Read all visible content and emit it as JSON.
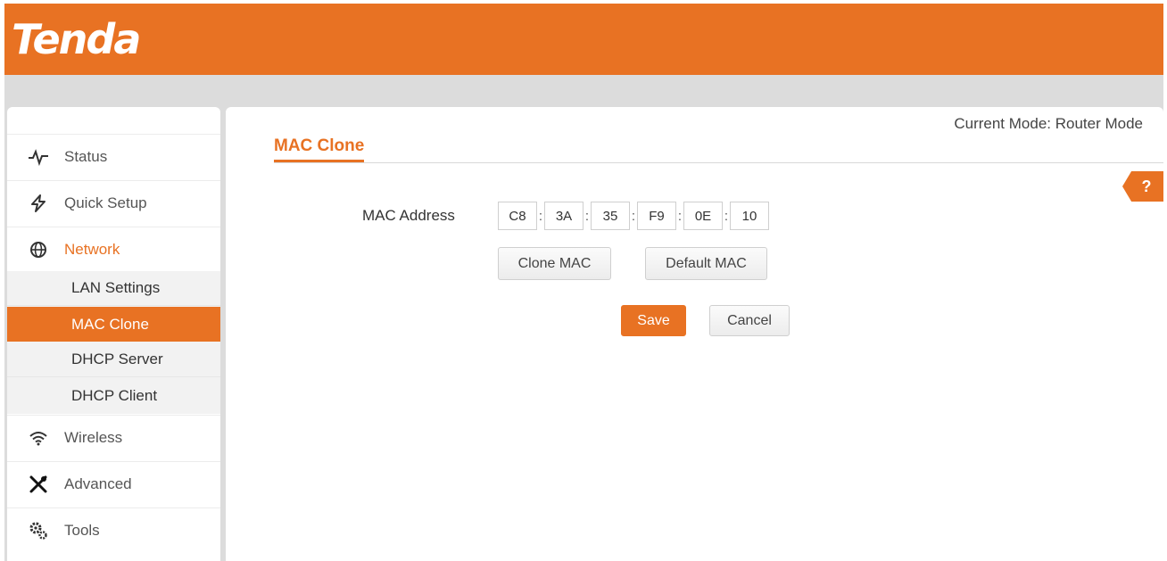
{
  "header": {
    "logo_text": "Tenda"
  },
  "sidebar": {
    "items": [
      {
        "label": "Status",
        "icon": "pulse-icon"
      },
      {
        "label": "Quick Setup",
        "icon": "lightning-icon"
      },
      {
        "label": "Network",
        "icon": "globe-icon"
      },
      {
        "label": "Wireless",
        "icon": "wifi-icon"
      },
      {
        "label": "Advanced",
        "icon": "tools-cross-icon"
      },
      {
        "label": "Tools",
        "icon": "gears-icon"
      }
    ],
    "network_sub": [
      {
        "label": "LAN Settings"
      },
      {
        "label": "MAC Clone"
      },
      {
        "label": "DHCP Server"
      },
      {
        "label": "DHCP Client"
      }
    ]
  },
  "main": {
    "mode_text": "Current Mode: Router Mode",
    "page_title": "MAC Clone",
    "help_label": "?",
    "mac_label": "MAC Address",
    "mac_octets": [
      "C8",
      "3A",
      "35",
      "F9",
      "0E",
      "10"
    ],
    "mac_separator": ":",
    "clone_button": "Clone MAC",
    "default_button": "Default MAC",
    "save_button": "Save",
    "cancel_button": "Cancel"
  },
  "colors": {
    "accent": "#e87223",
    "background": "#dcdcdc"
  }
}
